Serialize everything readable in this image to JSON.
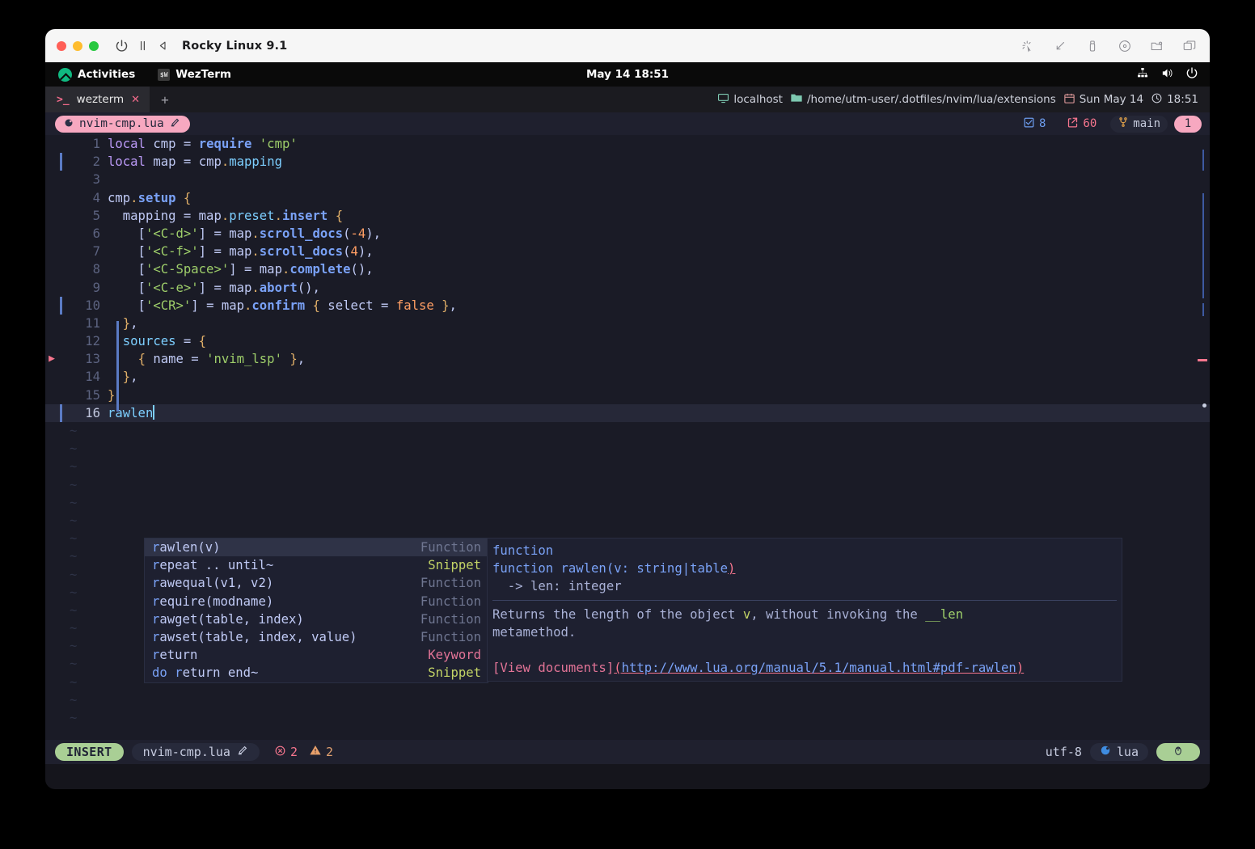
{
  "window": {
    "title": "Rocky Linux 9.1",
    "toolbar_icons_left": [
      "power-icon",
      "pause-icon",
      "rewind-icon"
    ],
    "toolbar_icons_right": [
      "cursor-capture-icon",
      "resize-icon",
      "usb-icon",
      "disc-icon",
      "shared-folder-icon",
      "windows-icon"
    ]
  },
  "gnome": {
    "activities": "Activities",
    "app": "WezTerm",
    "clock": "May 14  18:51",
    "tray_icons": [
      "network-icon",
      "volume-icon",
      "power-icon"
    ]
  },
  "wezterm": {
    "tab_label": "wezterm",
    "tab_prompt": ">_",
    "close_label": "✕",
    "new_tab_label": "+",
    "status": {
      "host": "localhost",
      "path": "/home/utm-user/.dotfiles/nvim/lua/extensions",
      "date": "Sun May 14",
      "time": "18:51"
    }
  },
  "bufferline": {
    "buffer_name": "nvim-cmp.lua",
    "modified_icon": "pencil-icon",
    "lua_icon": "lua-icon",
    "diagnostics_count": "8",
    "changes_count": "60",
    "branch": "main",
    "buffer_badge": "1"
  },
  "editor": {
    "lines": [
      {
        "num": "1",
        "sign": "",
        "gitbar": false,
        "tokens": [
          [
            "kw",
            "local"
          ],
          [
            "id",
            " cmp "
          ],
          [
            "id",
            "= "
          ],
          [
            "fn",
            "require"
          ],
          [
            "id",
            " "
          ],
          [
            "str",
            "'cmp'"
          ]
        ]
      },
      {
        "num": "2",
        "sign": "",
        "gitbar": true,
        "tokens": [
          [
            "kw",
            "local"
          ],
          [
            "id",
            " map "
          ],
          [
            "id",
            "= "
          ],
          [
            "id",
            "cmp"
          ],
          [
            "punct",
            "."
          ],
          [
            "prop",
            "mapping"
          ]
        ]
      },
      {
        "num": "3",
        "sign": "",
        "gitbar": false,
        "tokens": []
      },
      {
        "num": "4",
        "sign": "",
        "gitbar": false,
        "tokens": [
          [
            "id",
            "cmp"
          ],
          [
            "punct",
            "."
          ],
          [
            "fn",
            "setup"
          ],
          [
            "id",
            " "
          ],
          [
            "punct",
            "{"
          ]
        ]
      },
      {
        "num": "5",
        "sign": "",
        "gitbar": false,
        "tokens": [
          [
            "id",
            "  mapping "
          ],
          [
            "id",
            "= "
          ],
          [
            "id",
            "map"
          ],
          [
            "punct",
            "."
          ],
          [
            "prop",
            "preset"
          ],
          [
            "punct",
            "."
          ],
          [
            "fn",
            "insert"
          ],
          [
            "id",
            " "
          ],
          [
            "punct",
            "{"
          ]
        ]
      },
      {
        "num": "6",
        "sign": "",
        "gitbar": false,
        "tokens": [
          [
            "id",
            "    ["
          ],
          [
            "str",
            "'<C-d>'"
          ],
          [
            "id",
            "] "
          ],
          [
            "id",
            "= "
          ],
          [
            "id",
            "map"
          ],
          [
            "punct",
            "."
          ],
          [
            "fn",
            "scroll_docs"
          ],
          [
            "id",
            "("
          ],
          [
            "num",
            "-4"
          ],
          [
            "id",
            "),"
          ]
        ]
      },
      {
        "num": "7",
        "sign": "",
        "gitbar": false,
        "tokens": [
          [
            "id",
            "    ["
          ],
          [
            "str",
            "'<C-f>'"
          ],
          [
            "id",
            "] "
          ],
          [
            "id",
            "= "
          ],
          [
            "id",
            "map"
          ],
          [
            "punct",
            "."
          ],
          [
            "fn",
            "scroll_docs"
          ],
          [
            "id",
            "("
          ],
          [
            "num",
            "4"
          ],
          [
            "id",
            "),"
          ]
        ]
      },
      {
        "num": "8",
        "sign": "",
        "gitbar": false,
        "tokens": [
          [
            "id",
            "    ["
          ],
          [
            "str",
            "'<C-Space>'"
          ],
          [
            "id",
            "] "
          ],
          [
            "id",
            "= "
          ],
          [
            "id",
            "map"
          ],
          [
            "punct",
            "."
          ],
          [
            "fn",
            "complete"
          ],
          [
            "id",
            "(),"
          ]
        ]
      },
      {
        "num": "9",
        "sign": "",
        "gitbar": false,
        "tokens": [
          [
            "id",
            "    ["
          ],
          [
            "str",
            "'<C-e>'"
          ],
          [
            "id",
            "] "
          ],
          [
            "id",
            "= "
          ],
          [
            "id",
            "map"
          ],
          [
            "punct",
            "."
          ],
          [
            "fn",
            "abort"
          ],
          [
            "id",
            "(),"
          ]
        ]
      },
      {
        "num": "10",
        "sign": "",
        "gitbar": true,
        "tokens": [
          [
            "id",
            "    ["
          ],
          [
            "str",
            "'<CR>'"
          ],
          [
            "id",
            "] "
          ],
          [
            "id",
            "= "
          ],
          [
            "id",
            "map"
          ],
          [
            "punct",
            "."
          ],
          [
            "fn",
            "confirm"
          ],
          [
            "id",
            " "
          ],
          [
            "punct",
            "{"
          ],
          [
            "id",
            " select "
          ],
          [
            "id",
            "= "
          ],
          [
            "bool",
            "false"
          ],
          [
            "id",
            " "
          ],
          [
            "punct",
            "}"
          ],
          [
            "id",
            ","
          ]
        ]
      },
      {
        "num": "11",
        "sign": "",
        "gitbar": false,
        "tokens": [
          [
            "id",
            "  "
          ],
          [
            "punct",
            "}"
          ],
          [
            "id",
            ","
          ]
        ]
      },
      {
        "num": "12",
        "sign": "",
        "gitbar": false,
        "tokens": [
          [
            "id",
            "  "
          ],
          [
            "prop",
            "sources"
          ],
          [
            "id",
            " = "
          ],
          [
            "punct",
            "{"
          ]
        ]
      },
      {
        "num": "13",
        "sign": "▶",
        "gitbar": false,
        "tokens": [
          [
            "id",
            "    "
          ],
          [
            "punct",
            "{"
          ],
          [
            "id",
            " name "
          ],
          [
            "id",
            "= "
          ],
          [
            "str",
            "'nvim_lsp'"
          ],
          [
            "id",
            " "
          ],
          [
            "punct",
            "}"
          ],
          [
            "id",
            ","
          ]
        ]
      },
      {
        "num": "14",
        "sign": "",
        "gitbar": false,
        "tokens": [
          [
            "id",
            "  "
          ],
          [
            "punct",
            "}"
          ],
          [
            "id",
            ","
          ]
        ]
      },
      {
        "num": "15",
        "sign": "",
        "gitbar": false,
        "tokens": [
          [
            "punct",
            "}"
          ]
        ]
      },
      {
        "num": "16",
        "sign": "",
        "gitbar": true,
        "current": true,
        "tokens": [
          [
            "prop",
            "rawlen"
          ]
        ]
      }
    ],
    "empty_line_marker": "~"
  },
  "completion": {
    "items": [
      {
        "match": "r",
        "label": "awlen(v)",
        "kind": "Function",
        "selected": true
      },
      {
        "match": "r",
        "label": "epeat .. until~",
        "kind": "Snippet"
      },
      {
        "match": "r",
        "label": "awequal(v1, v2)",
        "kind": "Function"
      },
      {
        "match": "r",
        "label": "equire(modname)",
        "kind": "Function"
      },
      {
        "match": "r",
        "label": "awget(table, index)",
        "kind": "Function"
      },
      {
        "match": "r",
        "label": "awset(table, index, value)",
        "kind": "Function"
      },
      {
        "match": "r",
        "label": "eturn",
        "kind": "Keyword"
      },
      {
        "match": "do r",
        "label": "eturn end~",
        "kind": "Snippet"
      }
    ]
  },
  "documentation": {
    "line1": "function",
    "line2_prefix": "function rawlen(v: string|table",
    "line2_paren": ")",
    "line3": "  -> len: integer",
    "body_pre": "Returns the length of the object ",
    "body_v": "v",
    "body_mid": ", without invoking the ",
    "body_len": "__len",
    "body_post": "metamethod.",
    "link_label": "[View documents]",
    "link_open": "(",
    "link_url": "http://www.lua.org/manual/5.1/manual.html#pdf-rawlen",
    "link_close": ")"
  },
  "statusline": {
    "mode": "INSERT",
    "file": "nvim-cmp.lua",
    "modified_icon": "pencil-icon",
    "error_icon": "error-icon",
    "error_count": "2",
    "warn_icon": "warning-icon",
    "warn_count": "2",
    "encoding": "utf-8",
    "filetype": "lua",
    "os_icon": "linux-penguin-icon"
  }
}
